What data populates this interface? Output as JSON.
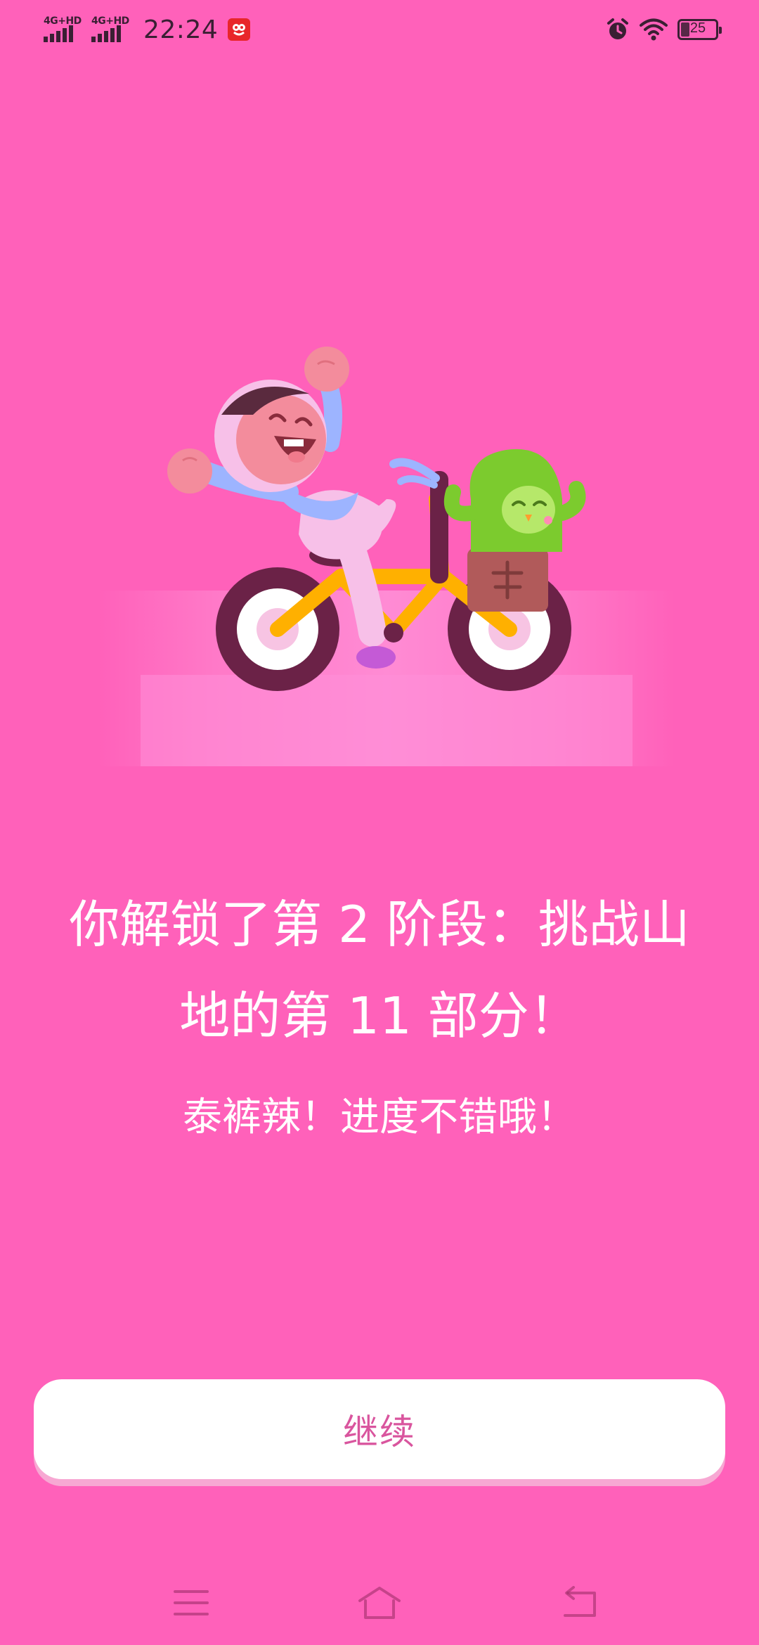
{
  "status_bar": {
    "network_1": "4G+HD",
    "network_2": "4G+HD",
    "time": "22:24",
    "battery_level": "25",
    "icons": [
      "signal-icon",
      "signal-icon",
      "notification-app-icon",
      "alarm-icon",
      "wifi-icon",
      "battery-icon"
    ]
  },
  "illustration": {
    "description_icon": "character-on-bicycle-illustration"
  },
  "content": {
    "title": "你解锁了第 2 阶段：挑战山地的第 11 部分！",
    "subtitle": "泰裤辣！进度不错哦！"
  },
  "actions": {
    "continue_label": "继续"
  },
  "nav_bar": {
    "icons": [
      "menu-icon",
      "home-icon",
      "back-icon"
    ]
  },
  "colors": {
    "background": "#FF61BA",
    "button_background": "#FFFFFF",
    "button_text": "#D9559E",
    "button_shadow": "#F7A8D3",
    "text": "#FFFFFF"
  }
}
